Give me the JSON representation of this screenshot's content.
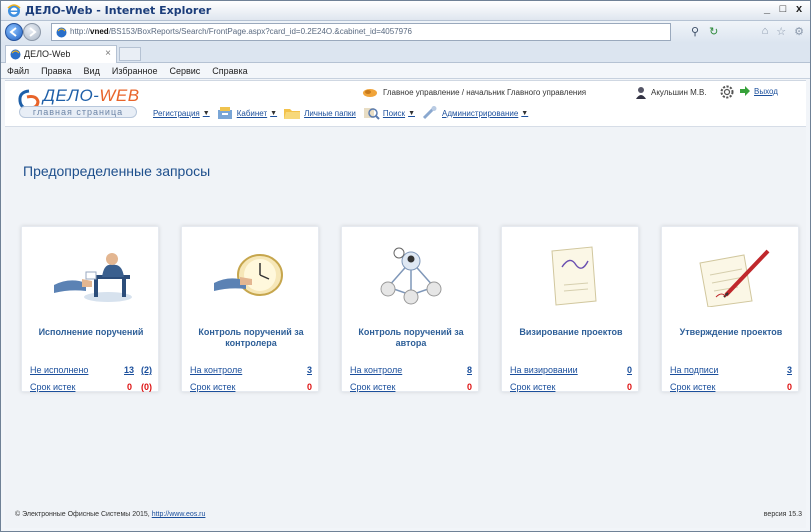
{
  "window": {
    "title": "ДЕЛО-Web - Internet Explorer",
    "controls": [
      "_",
      "□",
      "x"
    ]
  },
  "address": {
    "url_prefix": "http://",
    "url_host": "vned",
    "url_rest": "/BS153/BoxReports/Search/FrontPage.aspx?card_id=0.2E24O.&cabinet_id=4057976"
  },
  "tab": {
    "label": "ДЕЛО-Web",
    "close": "×"
  },
  "menu": [
    "Файл",
    "Правка",
    "Вид",
    "Избранное",
    "Сервис",
    "Справка"
  ],
  "app": {
    "logo_title": "ДЕЛО-",
    "logo_title_accent": "WEB",
    "logo_sub": "главная страница",
    "org": "Главное управление / начальник Главного управления",
    "user": "Акульшин М.В.",
    "exit": "Выход",
    "nav": [
      {
        "label": "Регистрация",
        "caret": "▼"
      },
      {
        "label": "Кабинет",
        "caret": "▼"
      },
      {
        "label": "Личные папки"
      },
      {
        "label": "Поиск",
        "caret": "▼"
      },
      {
        "label": "Администрирование",
        "caret": "▼"
      }
    ]
  },
  "page_title": "Предопределенные запросы",
  "cards": [
    {
      "title": "Исполнение поручений",
      "rows": [
        {
          "label": "Не исполнено",
          "value": "13",
          "value2": "(2)",
          "red": false
        },
        {
          "label": "Срок истек",
          "value": "0",
          "value2": "(0)",
          "red": true
        }
      ]
    },
    {
      "title": "Контроль поручений за контролера",
      "rows": [
        {
          "label": "На контроле",
          "value": "3",
          "red": false
        },
        {
          "label": "Срок истек",
          "value": "0",
          "red": true
        }
      ]
    },
    {
      "title": "Контроль поручений за автора",
      "rows": [
        {
          "label": "На контроле",
          "value": "8",
          "red": false
        },
        {
          "label": "Срок истек",
          "value": "0",
          "red": true
        }
      ]
    },
    {
      "title": "Визирование проектов",
      "rows": [
        {
          "label": "На визировании",
          "value": "0",
          "red": false
        },
        {
          "label": "Срок истек",
          "value": "0",
          "red": true
        }
      ]
    },
    {
      "title": "Утверждение проектов",
      "rows": [
        {
          "label": "На подписи",
          "value": "3",
          "red": false
        },
        {
          "label": "Срок истек",
          "value": "0",
          "red": true
        }
      ]
    }
  ],
  "footer": {
    "copyright": "© Электронные Офисные Системы 2015,",
    "link": "http://www.eos.ru",
    "version": "версия 15.3"
  },
  "colors": {
    "accent": "#1e5fa8",
    "logo_accent": "#e8642a",
    "link": "#1b4f9c",
    "alert": "#d11111"
  }
}
